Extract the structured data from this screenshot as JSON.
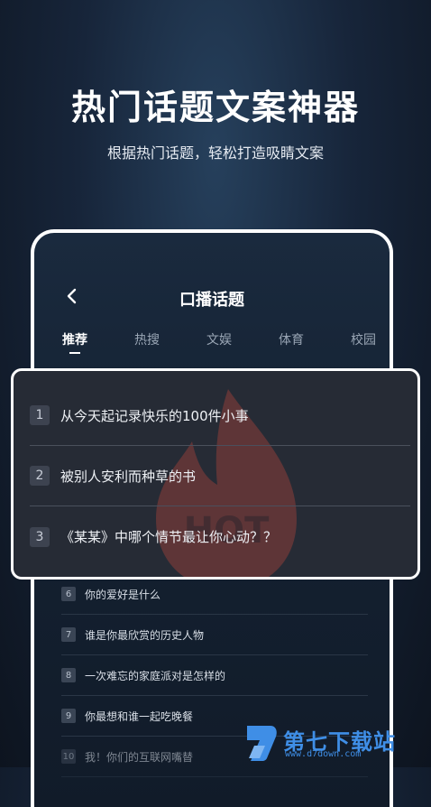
{
  "banner": {
    "headline": "热门话题文案神器",
    "subline": "根据热门话题，轻松打造吸睛文案"
  },
  "screen": {
    "title": "口播话题",
    "tabs": [
      {
        "label": "推荐",
        "active": true
      },
      {
        "label": "热搜",
        "active": false
      },
      {
        "label": "文娱",
        "active": false
      },
      {
        "label": "体育",
        "active": false
      },
      {
        "label": "校园",
        "active": false
      }
    ],
    "list": [
      {
        "num": "6",
        "text": "你的爱好是什么"
      },
      {
        "num": "7",
        "text": "谁是你最欣赏的历史人物"
      },
      {
        "num": "8",
        "text": "一次难忘的家庭派对是怎样的"
      },
      {
        "num": "9",
        "text": "你最想和谁一起吃晚餐"
      },
      {
        "num": "10",
        "text": "我！你们的互联网嘴替"
      }
    ]
  },
  "popup": {
    "items": [
      {
        "num": "1",
        "text": "从今天起记录快乐的100件小事"
      },
      {
        "num": "2",
        "text": "被别人安利而种草的书"
      },
      {
        "num": "3",
        "text": "《某某》中哪个情节最让你心动？？"
      }
    ],
    "badge_text": "HOT"
  },
  "watermark": {
    "brand": "第七下载站",
    "url": "www.d7down.com"
  },
  "colors": {
    "accent_flame": "#d84a3c",
    "watermark_blue": "#3f8ee6"
  },
  "icons": {
    "back": "chevron-left-icon",
    "flame": "hot-flame-icon"
  }
}
